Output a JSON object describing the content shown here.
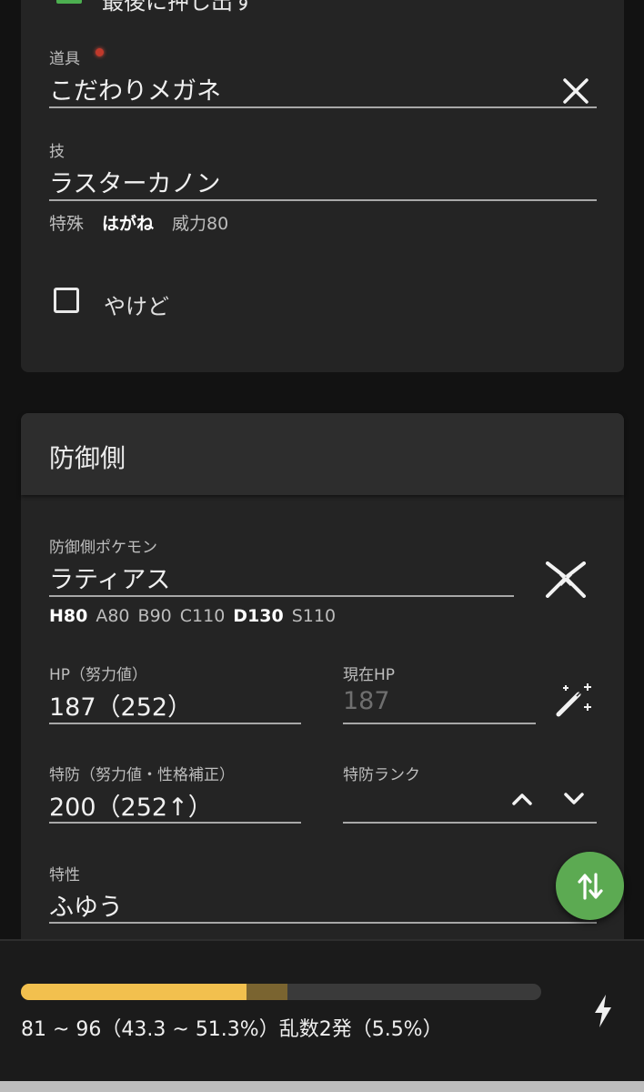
{
  "attacker": {
    "cut_off_checkbox_label": "最後に押し出す",
    "item": {
      "label": "道具",
      "value": "こだわりメガネ"
    },
    "move": {
      "label": "技",
      "value": "ラスターカノン",
      "category": "特殊",
      "type": "はがね",
      "power": "威力80"
    },
    "burn": {
      "label": "やけど",
      "checked": false
    }
  },
  "defender": {
    "title": "防御側",
    "pokemon": {
      "label": "防御側ポケモン",
      "value": "ラティアス"
    },
    "stats": [
      {
        "text": "H80",
        "highlight": true
      },
      {
        "text": "A80",
        "highlight": false
      },
      {
        "text": "B90",
        "highlight": false
      },
      {
        "text": "C110",
        "highlight": false
      },
      {
        "text": "D130",
        "highlight": true
      },
      {
        "text": "S110",
        "highlight": false
      }
    ],
    "hp": {
      "label": "HP（努力値）",
      "value": "187（252）"
    },
    "current_hp": {
      "label": "現在HP",
      "placeholder": "187"
    },
    "spdef": {
      "label": "特防（努力値・性格補正）",
      "value": "200（252↑）"
    },
    "spdef_rank": {
      "label": "特防ランク",
      "value": ""
    },
    "ability": {
      "label": "特性",
      "value": "ふゆう"
    }
  },
  "result": {
    "text": "81 ~ 96（43.3 ~ 51.3%）乱数2発（5.5%）",
    "min_percent": 43.3,
    "max_percent": 51.3
  },
  "colors": {
    "accent_green": "#5caa52",
    "bar_fill": "#f2c04e",
    "bar_range": "#7a6430",
    "bar_track": "#3a3a3a"
  },
  "icons": {
    "clear": "close-icon",
    "pokemon": "crossed-swords-icon",
    "current_hp": "magic-wand-icon",
    "rank_up": "chevron-up-icon",
    "rank_down": "chevron-down-icon",
    "swap": "swap-vertical-icon",
    "result": "lightning-icon"
  }
}
